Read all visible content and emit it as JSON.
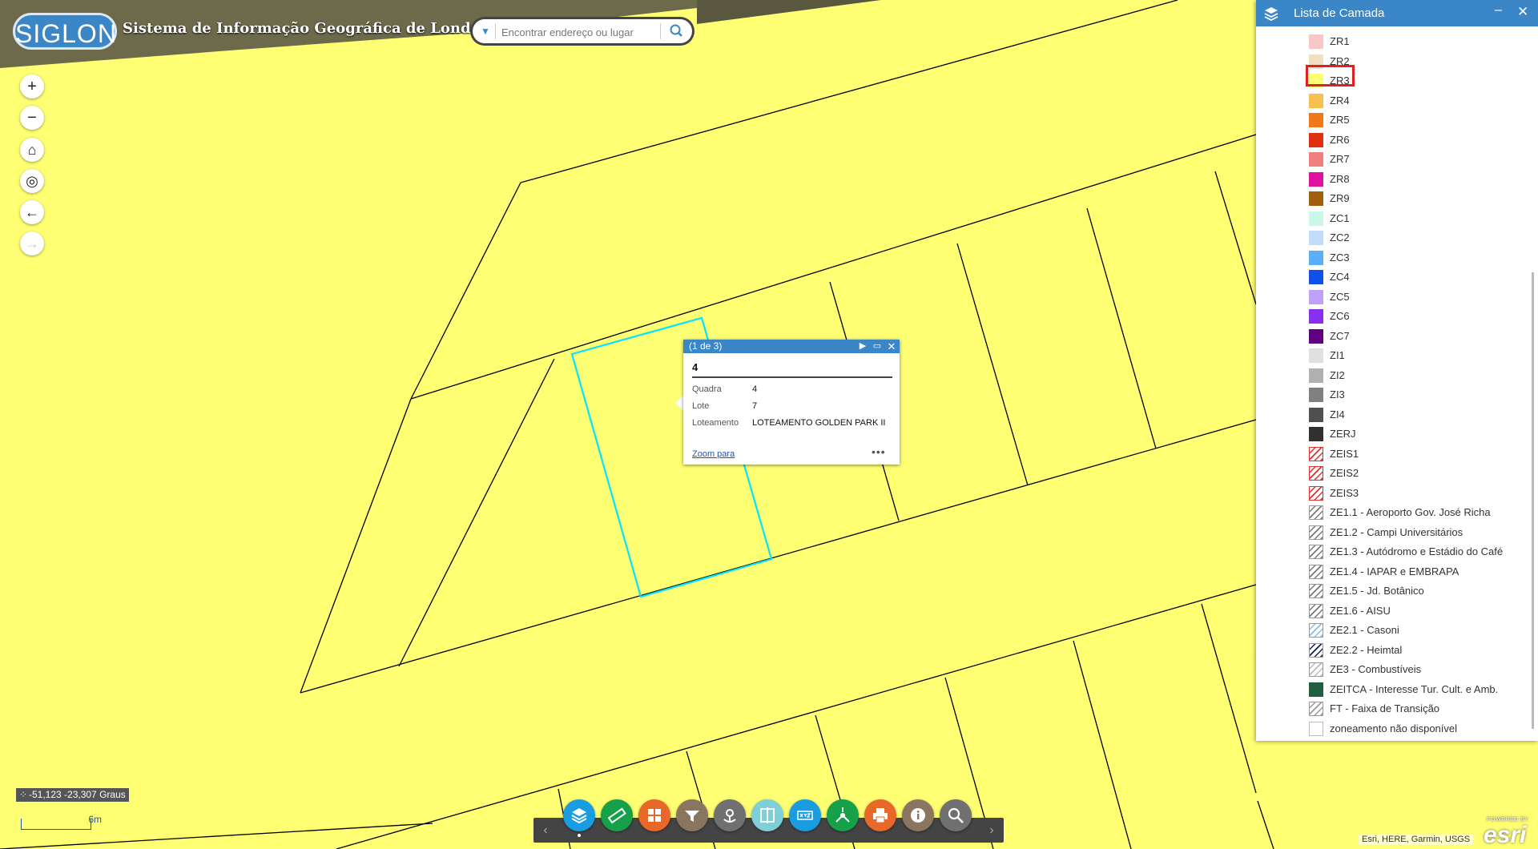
{
  "header": {
    "logo_text": "SIGLON",
    "title": "Sistema de Informação Geográfica de Londrina",
    "search_placeholder": "Encontrar endereço ou lugar"
  },
  "map": {
    "background_color": "#ffff73",
    "selected_outline_color": "#00e5ff",
    "coordinates": "-51,123 -23,307 Graus",
    "scale_label": "6m",
    "attribution": "Esri, HERE, Garmin, USGS",
    "esri_powered": "POWERED BY",
    "esri_name": "esri"
  },
  "nav_buttons": [
    {
      "name": "zoom-in",
      "glyph": "+"
    },
    {
      "name": "zoom-out",
      "glyph": "−"
    },
    {
      "name": "home",
      "glyph": "⌂"
    },
    {
      "name": "locate",
      "glyph": "◎"
    },
    {
      "name": "previous-extent",
      "glyph": "←"
    },
    {
      "name": "next-extent",
      "glyph": "→"
    }
  ],
  "popup": {
    "counter": "(1 de 3)",
    "title": "4",
    "fields": [
      {
        "label": "Quadra",
        "value": "4"
      },
      {
        "label": "Lote",
        "value": "7"
      },
      {
        "label": "Loteamento",
        "value": "LOTEAMENTO GOLDEN PARK II"
      }
    ],
    "zoom_link": "Zoom para",
    "more": "•••"
  },
  "layer_list": {
    "title": "Lista de Camada",
    "selected": "ZR3",
    "items": [
      {
        "label": "ZR1",
        "color": "#f8c8c8"
      },
      {
        "label": "ZR2",
        "color": "#f0e0c0"
      },
      {
        "label": "ZR3",
        "color": "#ffff73"
      },
      {
        "label": "ZR4",
        "color": "#f8c050"
      },
      {
        "label": "ZR5",
        "color": "#f07818"
      },
      {
        "label": "ZR6",
        "color": "#e03010"
      },
      {
        "label": "ZR7",
        "color": "#f08080"
      },
      {
        "label": "ZR8",
        "color": "#e010a0"
      },
      {
        "label": "ZR9",
        "color": "#a06010"
      },
      {
        "label": "ZC1",
        "color": "#c8f8e8"
      },
      {
        "label": "ZC2",
        "color": "#c0dcf8"
      },
      {
        "label": "ZC3",
        "color": "#58b0f8"
      },
      {
        "label": "ZC4",
        "color": "#1050e8"
      },
      {
        "label": "ZC5",
        "color": "#c0a0f8"
      },
      {
        "label": "ZC6",
        "color": "#8830f0"
      },
      {
        "label": "ZC7",
        "color": "#600080"
      },
      {
        "label": "ZI1",
        "color": "#e0e0e0"
      },
      {
        "label": "ZI2",
        "color": "#b0b0b0"
      },
      {
        "label": "ZI3",
        "color": "#808080"
      },
      {
        "label": "ZI4",
        "color": "#505050"
      },
      {
        "label": "ZERJ",
        "color": "#303030"
      },
      {
        "label": "ZEIS1",
        "color": "#e03030"
      },
      {
        "label": "ZEIS2",
        "color": "#e03030"
      },
      {
        "label": "ZEIS3",
        "color": "#e03030"
      },
      {
        "label": "ZE1.1 - Aeroporto Gov. José Richa",
        "color": "#777777"
      },
      {
        "label": "ZE1.2 - Campi Universitários",
        "color": "#777777"
      },
      {
        "label": "ZE1.3 - Autódromo e Estádio do Café",
        "color": "#777777"
      },
      {
        "label": "ZE1.4 - IAPAR e EMBRAPA",
        "color": "#777777"
      },
      {
        "label": "ZE1.5 - Jd. Botânico",
        "color": "#777777"
      },
      {
        "label": "ZE1.6 - AISU",
        "color": "#777777"
      },
      {
        "label": "ZE2.1 - Casoni",
        "color": "#88bbe8"
      },
      {
        "label": "ZE2.2 - Heimtal",
        "color": "#102060"
      },
      {
        "label": "ZE3 - Combustíveis",
        "color": "#bbbbbb"
      },
      {
        "label": "ZEITCA - Interesse Tur. Cult. e Amb.",
        "color": "#206040"
      },
      {
        "label": "FT - Faixa de Transição",
        "color": "#999999"
      },
      {
        "label": "zoneamento não disponível",
        "color": "#ffffff"
      }
    ]
  },
  "toolbar": {
    "tools": [
      {
        "name": "layer-list",
        "color": "#1a9de0"
      },
      {
        "name": "measurement",
        "color": "#17a04a"
      },
      {
        "name": "basemap-gallery",
        "color": "#e8682a"
      },
      {
        "name": "query",
        "color": "#8a7560"
      },
      {
        "name": "near-me",
        "color": "#707070"
      },
      {
        "name": "swipe",
        "color": "#7fcfd8"
      },
      {
        "name": "coordinate-conversion",
        "color": "#1a9de0"
      },
      {
        "name": "directions",
        "color": "#17a04a"
      },
      {
        "name": "print",
        "color": "#e8682a"
      },
      {
        "name": "about",
        "color": "#8a7560"
      },
      {
        "name": "search-tool",
        "color": "#707070"
      }
    ]
  }
}
